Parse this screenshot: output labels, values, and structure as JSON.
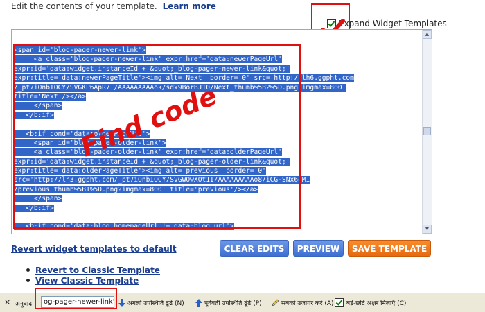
{
  "header": {
    "instruction": "Edit the contents of your template.",
    "learn_more": "Learn more"
  },
  "expand_widgets": {
    "label": "Expand Widget Templates",
    "checked": true
  },
  "editor": {
    "lines": [
      "<span id='blog-pager-newer-link'>",
      "     <a class='blog-pager-newer-link' expr:href='data:newerPageUrl'",
      "expr:id='data:widget.instanceId + &quot;_blog-pager-newer-link&quot;'",
      "expr:title='data:newerPageTitle'><img alt='Next' border='0' src='http://lh6.ggpht.com",
      "/_pt7iOnbIOCY/SVGKP6ApR7I/AAAAAAAAAok/sdx9BorBJ10/Next_thumb%5B2%5D.png?imgmax=800'",
      "title='Next'/></a>",
      "     </span>",
      "   </b:if>",
      "",
      "   <b:if cond='data:olderPageUrl'>",
      "     <span id='blog-pager-older-link'>",
      "     <a class='blog-pager-older-link' expr:href='data:olderPageUrl'",
      "expr:id='data:widget.instanceId + &quot;_blog-pager-older-link&quot;'",
      "expr:title='data:olderPageTitle'><img alt='previous' border='0'",
      "src='http://lh3.ggpht.com/_pt7iOnbIOCY/SVGWOwXOt1I/AAAAAAAAAo8/iCG-SNx6gMI",
      "/previous_thumb%5B1%5D.png?imgmax=800' title='previous'/></a>",
      "     </span>",
      "   </b:if>",
      "",
      "   <b:if cond='data:blog.homepageUrl != data:blog.url'>"
    ]
  },
  "annotation": {
    "text": "Find code"
  },
  "actions": {
    "revert_widget": "Revert widget templates to default",
    "clear_edits": "CLEAR EDITS",
    "preview": "PREVIEW",
    "save_template": "SAVE TEMPLATE"
  },
  "links": [
    "Revert to Classic Template",
    "View Classic Template"
  ],
  "findbar": {
    "close": "×",
    "label": "अनुवाद",
    "value": "og-pager-newer-link'>",
    "next": "अगली उपस्थिति ढूंढें (N)",
    "previous": "पूर्ववर्ती उपस्थिति ढूंढें (P)",
    "highlight": "सबको उजागर करें (A)",
    "match_case": "बड़े-छोटे अक्षर मिलाएँ (C)",
    "match_case_checked": true
  },
  "colors": {
    "selection": "#3165c8",
    "annotation_red": "#e01010",
    "button_blue": "#4a7bd8",
    "button_orange": "#f07a1a",
    "link": "#1a3d8f"
  }
}
